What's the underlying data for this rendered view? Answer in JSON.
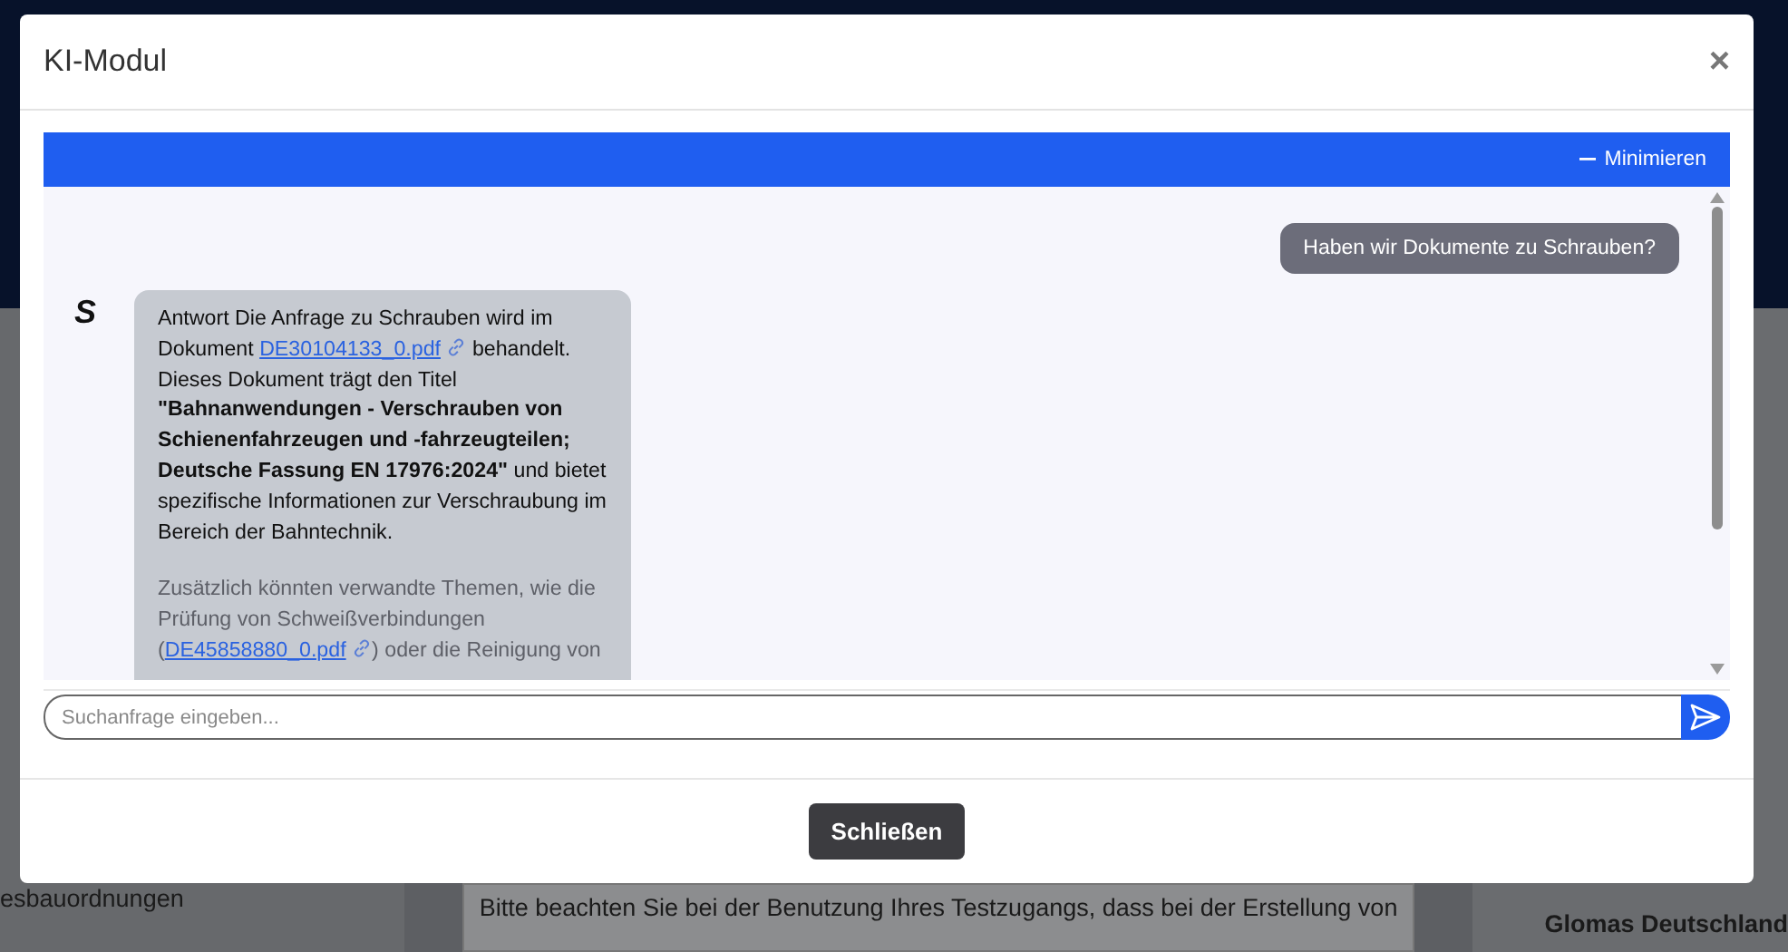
{
  "background": {
    "left_text": "esbauordnungen",
    "center_text": "Bitte beachten Sie bei der Benutzung Ihres Testzugangs, dass bei der Erstellung von",
    "right_text": "Glomas Deutschland"
  },
  "modal": {
    "title": "KI-Modul",
    "close": "×",
    "chat": {
      "minimize": "Minimieren",
      "messages": [
        {
          "kind": "user",
          "text": "Haben wir Dokumente zu Schrauben?"
        },
        {
          "kind": "bot",
          "avatar": "S",
          "paragraphs": [
            {
              "faded": false,
              "segments": [
                {
                  "kind": "text",
                  "text": "Antwort Die Anfrage zu Schrauben wird im Dokument "
                },
                {
                  "kind": "link",
                  "text": "DE30104133_0.pdf"
                },
                {
                  "kind": "text",
                  "text": " behandelt. Dieses Dokument trägt den Titel "
                },
                {
                  "kind": "bold",
                  "text": "\"Bahnanwendungen - Verschrauben von Schienenfahrzeugen und -fahrzeugteilen; Deutsche Fassung EN 17976:2024\""
                },
                {
                  "kind": "text",
                  "text": " und bietet spezifische Informationen zur Verschraubung im Bereich der Bahntechnik."
                }
              ]
            },
            {
              "faded": true,
              "segments": [
                {
                  "kind": "text",
                  "text": "Zusätzlich könnten verwandte Themen, wie die Prüfung von Schweißverbindungen ("
                },
                {
                  "kind": "link",
                  "text": "DE45858880_0.pdf"
                },
                {
                  "kind": "text",
                  "text": ") oder die Reinigung von"
                }
              ]
            }
          ]
        }
      ],
      "input": {
        "placeholder": "Suchanfrage eingeben..."
      }
    },
    "button": "Schließen"
  }
}
